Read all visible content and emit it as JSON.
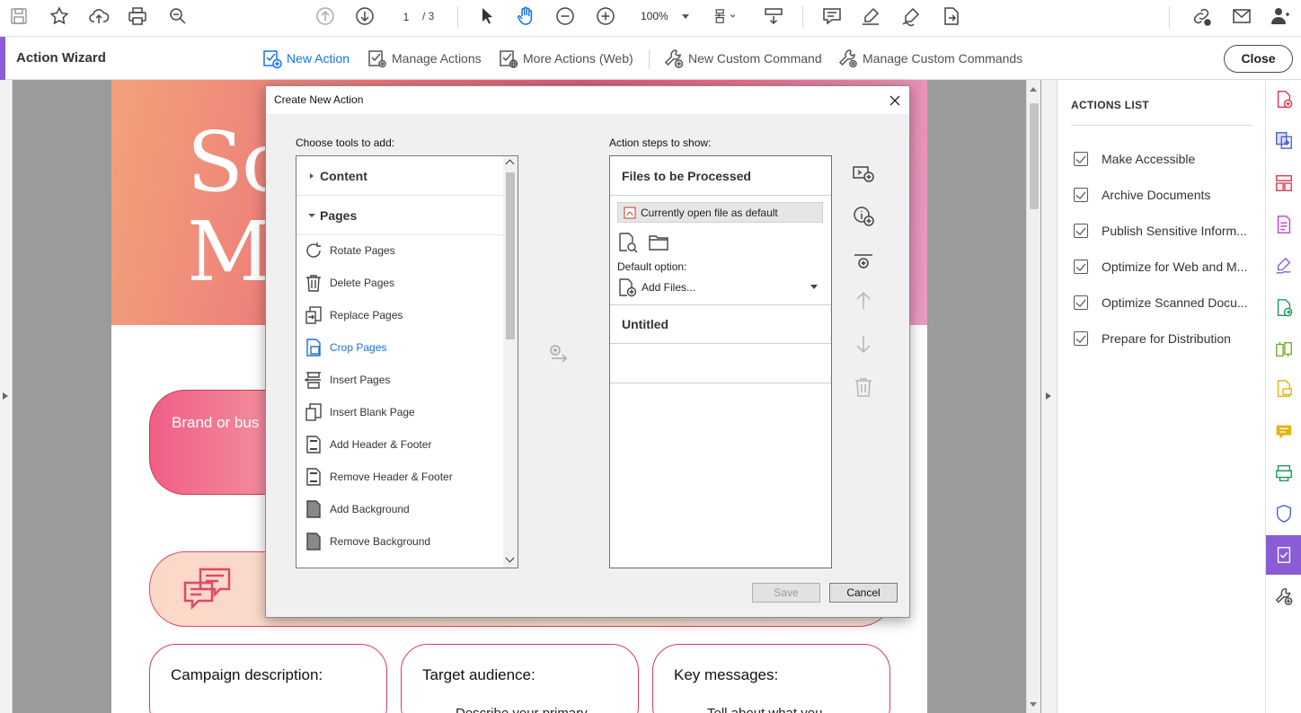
{
  "toolbar": {
    "page_current": "1",
    "page_total": "/ 3",
    "zoom": "100%"
  },
  "wizard": {
    "title": "Action Wizard",
    "new_action": "New Action",
    "manage_actions": "Manage Actions",
    "more_actions": "More Actions (Web)",
    "new_custom_command": "New Custom Command",
    "manage_custom_commands": "Manage Custom Commands",
    "close": "Close"
  },
  "document": {
    "hero_text_line1": "So",
    "hero_text_line2": "M",
    "pill_text": "Brand or bus",
    "cards": [
      {
        "title": "Campaign description:",
        "sub": ""
      },
      {
        "title": "Target audience:",
        "sub": "Describe your primary"
      },
      {
        "title": "Key messages:",
        "sub": "Tell about what you"
      }
    ]
  },
  "actions_list": {
    "title": "ACTIONS LIST",
    "items": [
      "Make Accessible",
      "Archive Documents",
      "Publish Sensitive Inform...",
      "Optimize for Web and M...",
      "Optimize Scanned Docu...",
      "Prepare for Distribution"
    ]
  },
  "dialog": {
    "title": "Create New Action",
    "choose_label": "Choose tools to add:",
    "steps_label": "Action steps to show:",
    "groups": {
      "content": "Content",
      "pages": "Pages"
    },
    "tools": [
      "Rotate Pages",
      "Delete Pages",
      "Replace Pages",
      "Crop Pages",
      "Insert Pages",
      "Insert Blank Page",
      "Add Header & Footer",
      "Remove Header & Footer",
      "Add Background",
      "Remove Background"
    ],
    "files_header": "Files to be Processed",
    "current_file": "Currently open file as default",
    "default_option_label": "Default option:",
    "add_files": "Add Files...",
    "untitled": "Untitled",
    "save": "Save",
    "cancel": "Cancel"
  },
  "colors": {
    "accent": "#8a5cd5",
    "link_blue": "#1473e6"
  }
}
